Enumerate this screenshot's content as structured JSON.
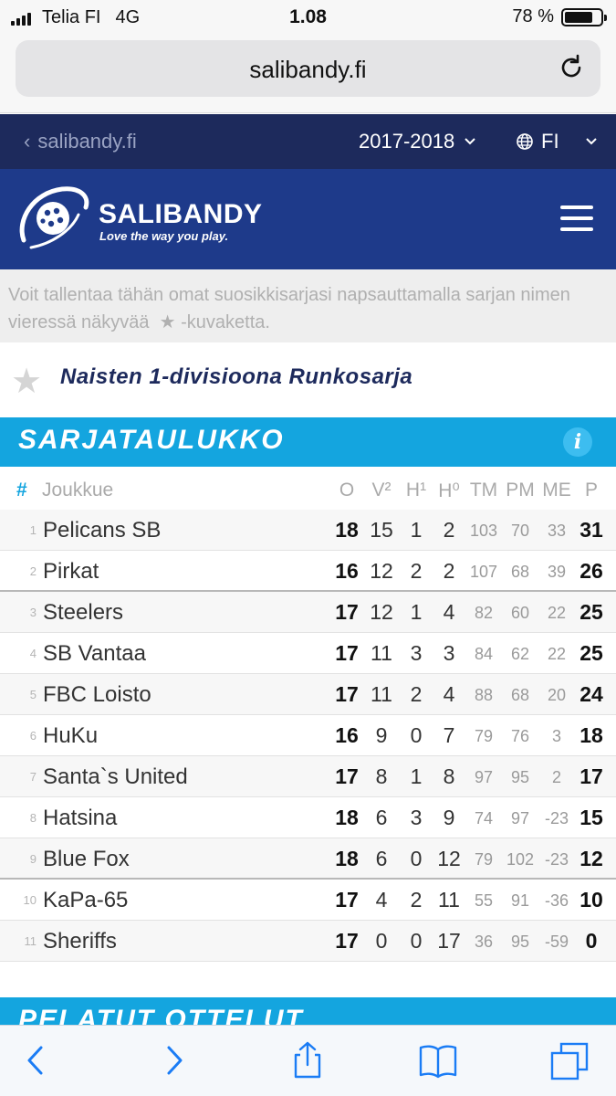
{
  "status_bar": {
    "carrier": "Telia FI",
    "network": "4G",
    "time": "1.08",
    "battery": "78 %",
    "battery_level": 0.78
  },
  "browser": {
    "url": "salibandy.fi"
  },
  "top_nav": {
    "back_label": "salibandy.fi",
    "season": "2017-2018",
    "language": "FI"
  },
  "brand": {
    "name": "SALIBANDY",
    "tagline": "Love the way you play."
  },
  "note": {
    "text_before": "Voit tallentaa tähän omat suosikkisarjasi napsauttamalla sarjan nimen vieressä näkyvää",
    "text_after": "-kuvaketta."
  },
  "series": {
    "title": "Naisten 1-divisioona Runkosarja"
  },
  "standings": {
    "heading": "SARJATAULUKKO",
    "info_icon_label": "i",
    "columns": {
      "rank": "#",
      "team": "Joukkue",
      "o": "O",
      "v": "V²",
      "h1": "H¹",
      "h0": "H⁰",
      "tm": "TM",
      "pm": "PM",
      "me": "ME",
      "p": "P"
    },
    "rows": [
      {
        "rank": "1",
        "team": "Pelicans SB",
        "o": "18",
        "v": "15",
        "h1": "1",
        "h0": "2",
        "tm": "103",
        "pm": "70",
        "me": "33",
        "p": "31"
      },
      {
        "rank": "2",
        "team": "Pirkat",
        "o": "16",
        "v": "12",
        "h1": "2",
        "h0": "2",
        "tm": "107",
        "pm": "68",
        "me": "39",
        "p": "26"
      },
      {
        "rank": "3",
        "team": "Steelers",
        "o": "17",
        "v": "12",
        "h1": "1",
        "h0": "4",
        "tm": "82",
        "pm": "60",
        "me": "22",
        "p": "25"
      },
      {
        "rank": "4",
        "team": "SB Vantaa",
        "o": "17",
        "v": "11",
        "h1": "3",
        "h0": "3",
        "tm": "84",
        "pm": "62",
        "me": "22",
        "p": "25"
      },
      {
        "rank": "5",
        "team": "FBC Loisto",
        "o": "17",
        "v": "11",
        "h1": "2",
        "h0": "4",
        "tm": "88",
        "pm": "68",
        "me": "20",
        "p": "24"
      },
      {
        "rank": "6",
        "team": "HuKu",
        "o": "16",
        "v": "9",
        "h1": "0",
        "h0": "7",
        "tm": "79",
        "pm": "76",
        "me": "3",
        "p": "18"
      },
      {
        "rank": "7",
        "team": "Santa`s United",
        "o": "17",
        "v": "8",
        "h1": "1",
        "h0": "8",
        "tm": "97",
        "pm": "95",
        "me": "2",
        "p": "17"
      },
      {
        "rank": "8",
        "team": "Hatsina",
        "o": "18",
        "v": "6",
        "h1": "3",
        "h0": "9",
        "tm": "74",
        "pm": "97",
        "me": "-23",
        "p": "15"
      },
      {
        "rank": "9",
        "team": "Blue Fox",
        "o": "18",
        "v": "6",
        "h1": "0",
        "h0": "12",
        "tm": "79",
        "pm": "102",
        "me": "-23",
        "p": "12"
      },
      {
        "rank": "10",
        "team": "KaPa-65",
        "o": "17",
        "v": "4",
        "h1": "2",
        "h0": "11",
        "tm": "55",
        "pm": "91",
        "me": "-36",
        "p": "10"
      },
      {
        "rank": "11",
        "team": "Sheriffs",
        "o": "17",
        "v": "0",
        "h1": "0",
        "h0": "17",
        "tm": "36",
        "pm": "95",
        "me": "-59",
        "p": "0"
      }
    ]
  },
  "next_section": {
    "heading": "PELATUT OTTELUT"
  },
  "toolbar": {
    "icons": [
      "back-icon",
      "forward-icon",
      "share-icon",
      "bookmarks-icon",
      "tabs-icon"
    ]
  },
  "colors": {
    "nav_dark": "#1d2a5c",
    "brand_blue": "#1e3a8a",
    "accent_cyan": "#14a5df"
  }
}
